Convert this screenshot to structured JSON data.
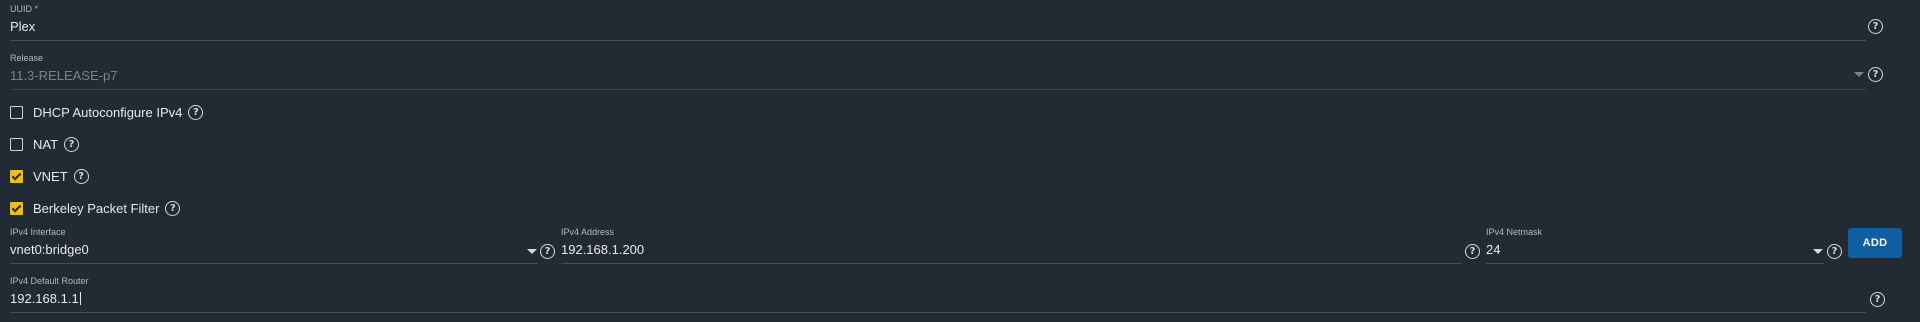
{
  "uuid": {
    "label": "UUID *",
    "value": "Plex"
  },
  "release": {
    "label": "Release",
    "value": "11.3-RELEASE-p7"
  },
  "checkboxes": [
    {
      "label": "DHCP Autoconfigure IPv4",
      "checked": false
    },
    {
      "label": "NAT",
      "checked": false
    },
    {
      "label": "VNET",
      "checked": true
    },
    {
      "label": "Berkeley Packet Filter",
      "checked": true
    }
  ],
  "ipv4_interface": {
    "label": "IPv4 Interface",
    "value": "vnet0:bridge0"
  },
  "ipv4_address": {
    "label": "IPv4 Address",
    "value": "192.168.1.200"
  },
  "ipv4_netmask": {
    "label": "IPv4 Netmask",
    "value": "24"
  },
  "add_button": {
    "label": "ADD"
  },
  "ipv4_default_router": {
    "label": "IPv4 Default Router",
    "value": "192.168.1.1"
  },
  "help_glyph": "?",
  "icons": {
    "help": "question-circle-icon",
    "dropdown": "caret-down-icon",
    "checkbox_checked": "check-icon"
  },
  "colors": {
    "background": "#222a33",
    "checkbox_checked": "#f2c200",
    "primary_button": "#0e5ea4",
    "text": "#e8eaed",
    "muted_text": "#b3b8be"
  }
}
